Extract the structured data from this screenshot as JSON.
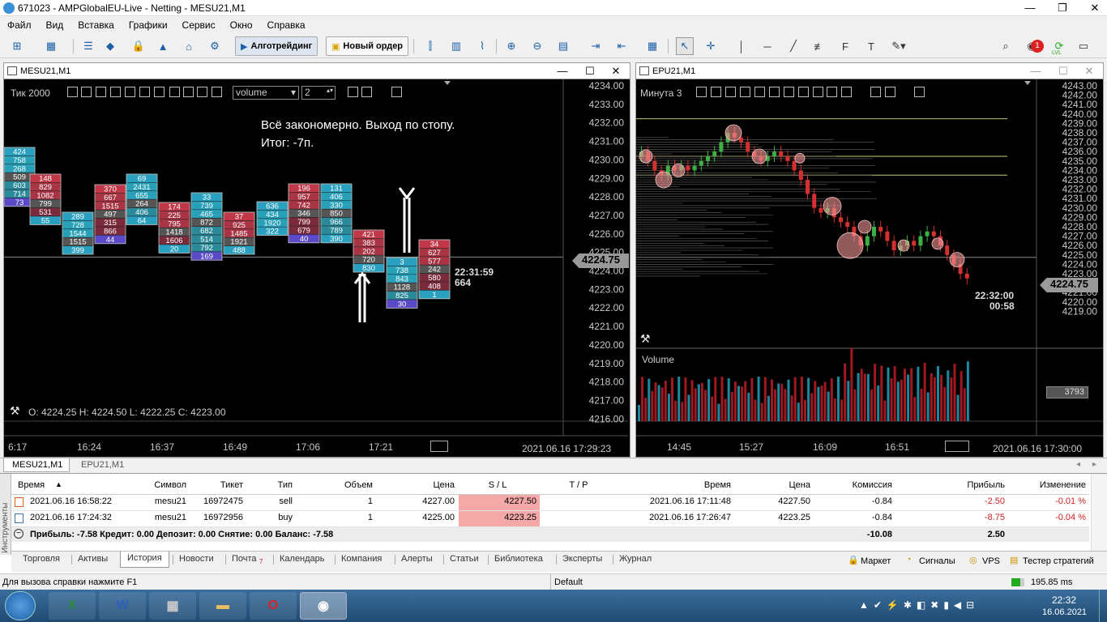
{
  "window": {
    "title": "671023 - AMPGlobalEU-Live - Netting - MESU21,M1"
  },
  "menu": [
    "Файл",
    "Вид",
    "Вставка",
    "Графики",
    "Сервис",
    "Окно",
    "Справка"
  ],
  "toolbar": {
    "algo": "Алготрейдинг",
    "new_order": "Новый ордер",
    "notif_count": "1",
    "lvl": "LVL"
  },
  "chart1": {
    "window_title": "MESU21,M1",
    "label": "Тик  2000",
    "indicator": "volume",
    "step": "2",
    "btns": [
      "H",
      "I",
      "/",
      "P",
      "R",
      "C",
      "A",
      "M"
    ],
    "annotation1": "Всё закономерно. Выход по стопу.",
    "annotation2": "Итог: -7п.",
    "ohlc": "O: 4224.25  H: 4224.50  L: 4222.25  C: 4223.00",
    "price_tag": "4224.75",
    "timer_time": "22:31:59",
    "timer_vol": "664",
    "yticks": [
      "4234.00",
      "4233.00",
      "4232.00",
      "4231.00",
      "4230.00",
      "4229.00",
      "4228.00",
      "4227.00",
      "4226.00",
      "4225.00",
      "4224.00",
      "4223.00",
      "4222.00",
      "4221.00",
      "4220.00",
      "4219.00",
      "4218.00",
      "4217.00",
      "4216.00"
    ],
    "xticks": [
      "6:17",
      "16:24",
      "16:37",
      "16:49",
      "17:06",
      "17:21"
    ],
    "datetime": "2021.06.16 17:29:23",
    "footprints": [
      {
        "cells": [
          "424",
          "758",
          "268",
          "509",
          "603",
          "714",
          "73"
        ]
      },
      {
        "cells": [
          "148",
          "829",
          "1082",
          "799",
          "531",
          "55"
        ]
      },
      {
        "cells": [
          "289",
          "728",
          "1544",
          "1515",
          "399"
        ]
      },
      {
        "cells": [
          "370",
          "667",
          "1515",
          "497",
          "315",
          "866",
          "44"
        ]
      },
      {
        "cells": [
          "69",
          "2431",
          "655",
          "264",
          "406",
          "64"
        ]
      },
      {
        "cells": [
          "174",
          "225",
          "795",
          "1418",
          "1606",
          "20"
        ]
      },
      {
        "cells": [
          "33",
          "739",
          "465",
          "872",
          "682",
          "514",
          "792",
          "169"
        ]
      },
      {
        "cells": [
          "37",
          "925",
          "1485",
          "1921",
          "488"
        ]
      },
      {
        "cells": [
          "636",
          "434",
          "1920",
          "322"
        ]
      },
      {
        "cells": [
          "196",
          "957",
          "742",
          "346",
          "799",
          "679",
          "40"
        ]
      },
      {
        "cells": [
          "131",
          "406",
          "330",
          "850",
          "966",
          "789",
          "390"
        ]
      },
      {
        "cells": [
          "421",
          "383",
          "202",
          "720",
          "830"
        ]
      },
      {
        "cells": [
          "3",
          "738",
          "843",
          "1128",
          "825",
          "30"
        ]
      },
      {
        "cells": [
          "34",
          "627",
          "577",
          "242",
          "580",
          "408",
          "1"
        ]
      }
    ]
  },
  "chart2": {
    "window_title": "EPU21,M1",
    "label": "Минута  3",
    "price_tag": "4224.75",
    "timer_time": "22:32:00",
    "timer_sec": "00:58",
    "volume_label": "Volume",
    "volume_value": "3793",
    "yticks": [
      "4243.00",
      "4242.00",
      "4241.00",
      "4240.00",
      "4239.00",
      "4238.00",
      "4237.00",
      "4236.00",
      "4235.00",
      "4234.00",
      "4233.00",
      "4232.00",
      "4231.00",
      "4230.00",
      "4229.00",
      "4228.00",
      "4227.00",
      "4226.00",
      "4225.00",
      "4224.00",
      "4223.00",
      "4222.00",
      "4221.00",
      "4220.00",
      "4219.00"
    ],
    "xticks": [
      "14:45",
      "15:27",
      "16:09",
      "16:51"
    ],
    "datetime": "2021.06.16 17:30:00"
  },
  "chart_tabs": [
    "MESU21,M1",
    "EPU21,M1"
  ],
  "trades": {
    "headers": [
      "Время",
      "Символ",
      "Тикет",
      "Тип",
      "Объем",
      "Цена",
      "S / L",
      "T / P",
      "Время",
      "Цена",
      "Комиссия",
      "Прибыль",
      "Изменение"
    ],
    "rows": [
      [
        "2021.06.16 16:58:22",
        "mesu21",
        "16972475",
        "sell",
        "1",
        "4227.00",
        "4227.50",
        "",
        "2021.06.16 17:11:48",
        "4227.50",
        "-0.84",
        "-2.50",
        "-0.01 %"
      ],
      [
        "2021.06.16 17:24:32",
        "mesu21",
        "16972956",
        "buy",
        "1",
        "4225.00",
        "4223.25",
        "",
        "2021.06.16 17:26:47",
        "4223.25",
        "-0.84",
        "-8.75",
        "-0.04 %"
      ]
    ],
    "summary": "Прибыль: -7.58  Кредит: 0.00  Депозит: 0.00  Снятие: 0.00  Баланс: -7.58",
    "total_commission": "-10.08",
    "total_profit": "2.50"
  },
  "side_label": "Инструменты",
  "bottom_tabs": [
    "Торговля",
    "Активы",
    "История",
    "Новости",
    "Почта",
    "Календарь",
    "Компания",
    "Алерты",
    "Статьи",
    "Библиотека",
    "Эксперты",
    "Журнал"
  ],
  "mail_count": "7",
  "right_links": [
    "Маркет",
    "Сигналы",
    "VPS",
    "Тестер стратегий"
  ],
  "status": {
    "help": "Для вызова справки нажмите F1",
    "profile": "Default",
    "ping": "195.85 ms"
  },
  "taskbar": {
    "time": "22:32",
    "date": "16.06.2021"
  }
}
